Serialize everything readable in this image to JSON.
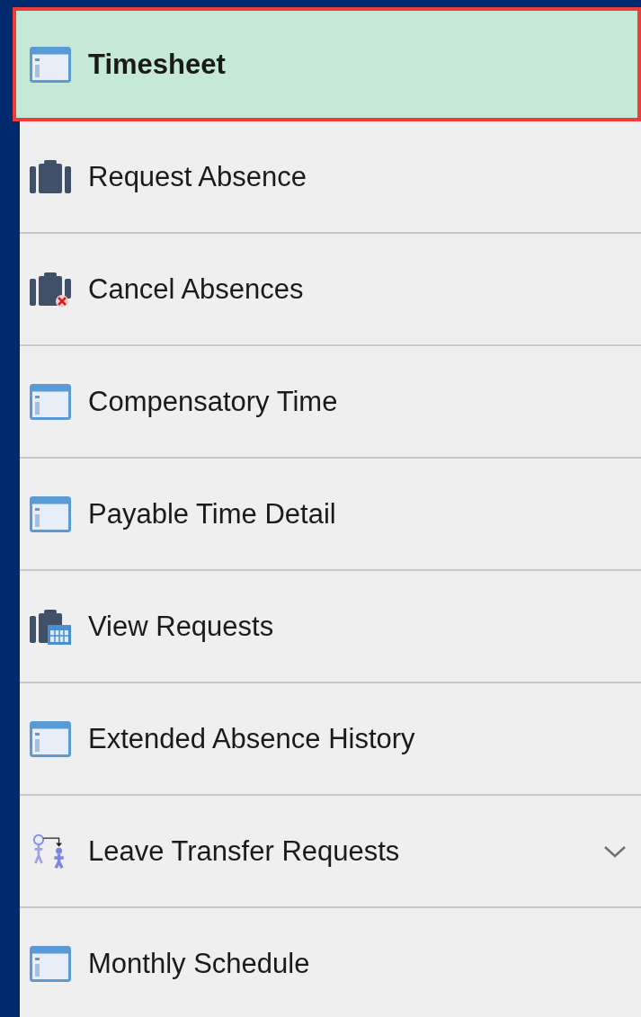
{
  "menu": {
    "items": [
      {
        "label": "Timesheet",
        "kind": "page",
        "selected": true,
        "expandable": false
      },
      {
        "label": "Request Absence",
        "kind": "briefcase",
        "selected": false,
        "expandable": false
      },
      {
        "label": "Cancel Absences",
        "kind": "briefcase-cancel",
        "selected": false,
        "expandable": false
      },
      {
        "label": "Compensatory Time",
        "kind": "page",
        "selected": false,
        "expandable": false
      },
      {
        "label": "Payable Time Detail",
        "kind": "page",
        "selected": false,
        "expandable": false
      },
      {
        "label": "View Requests",
        "kind": "briefcase-calendar",
        "selected": false,
        "expandable": false
      },
      {
        "label": "Extended Absence History",
        "kind": "page",
        "selected": false,
        "expandable": false
      },
      {
        "label": "Leave Transfer Requests",
        "kind": "transfer",
        "selected": false,
        "expandable": true
      },
      {
        "label": "Monthly Schedule",
        "kind": "page",
        "selected": false,
        "expandable": false
      }
    ]
  }
}
